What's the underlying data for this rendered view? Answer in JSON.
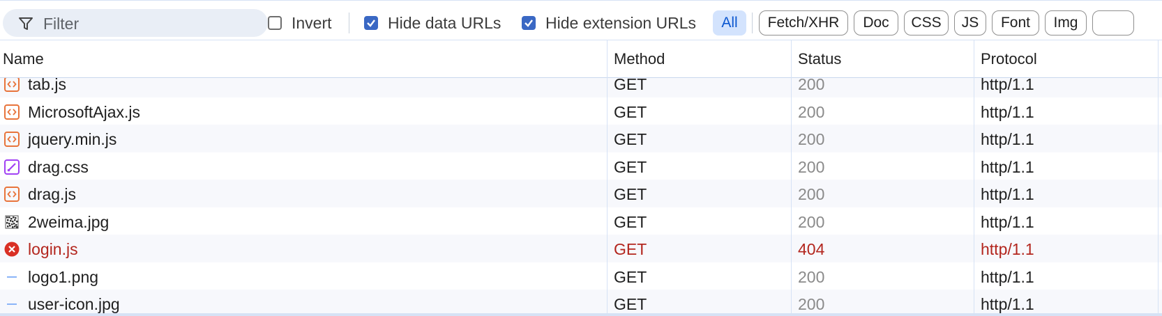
{
  "toolbar": {
    "filter_placeholder": "Filter",
    "invert_label": "Invert",
    "invert_checked": false,
    "hide_data_urls_label": "Hide data URLs",
    "hide_data_urls_checked": true,
    "hide_extension_urls_label": "Hide extension URLs",
    "hide_extension_urls_checked": true,
    "type_filters": [
      "All",
      "Fetch/XHR",
      "Doc",
      "CSS",
      "JS",
      "Font",
      "Img"
    ],
    "active_filter": "All"
  },
  "columns": {
    "name": "Name",
    "method": "Method",
    "status": "Status",
    "protocol": "Protocol"
  },
  "requests": [
    {
      "name": "tab.js",
      "icon": "script-icon",
      "method": "GET",
      "status": "200",
      "protocol": "http/1.1",
      "error": false
    },
    {
      "name": "MicrosoftAjax.js",
      "icon": "script-icon",
      "method": "GET",
      "status": "200",
      "protocol": "http/1.1",
      "error": false
    },
    {
      "name": "jquery.min.js",
      "icon": "script-icon",
      "method": "GET",
      "status": "200",
      "protocol": "http/1.1",
      "error": false
    },
    {
      "name": "drag.css",
      "icon": "stylesheet-icon",
      "method": "GET",
      "status": "200",
      "protocol": "http/1.1",
      "error": false
    },
    {
      "name": "drag.js",
      "icon": "script-icon",
      "method": "GET",
      "status": "200",
      "protocol": "http/1.1",
      "error": false
    },
    {
      "name": "2weima.jpg",
      "icon": "qr-image-icon",
      "method": "GET",
      "status": "200",
      "protocol": "http/1.1",
      "error": false
    },
    {
      "name": "login.js",
      "icon": "error-icon",
      "method": "GET",
      "status": "404",
      "protocol": "http/1.1",
      "error": true
    },
    {
      "name": "logo1.png",
      "icon": "image-icon",
      "method": "GET",
      "status": "200",
      "protocol": "http/1.1",
      "error": false
    },
    {
      "name": "user-icon.jpg",
      "icon": "image-icon",
      "method": "GET",
      "status": "200",
      "protocol": "http/1.1",
      "error": false
    }
  ],
  "colors": {
    "accent": "#3a68c4",
    "active_chip_bg": "#d3e3fd",
    "error_red": "#b3261e",
    "script_orange": "#e8743b",
    "css_purple": "#a142f4"
  }
}
